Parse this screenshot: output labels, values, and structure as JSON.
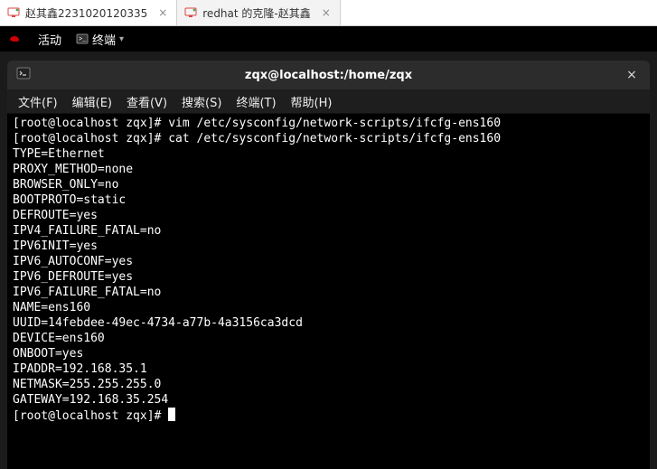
{
  "vm_tabs": [
    {
      "label": "赵其鑫2231020120335",
      "active": true
    },
    {
      "label": "redhat 的克隆-赵其鑫",
      "active": false
    }
  ],
  "panel": {
    "activities": "活动",
    "app": "终端"
  },
  "window": {
    "title": "zqx@localhost:/home/zqx",
    "close": "×"
  },
  "menu": {
    "file": "文件(F)",
    "edit": "编辑(E)",
    "view": "查看(V)",
    "search": "搜索(S)",
    "terminal": "终端(T)",
    "help": "帮助(H)"
  },
  "prompt": {
    "user_host": "[root@localhost zqx]#"
  },
  "terminal_lines": [
    {
      "prompt": true,
      "cmd": "vim /etc/sysconfig/network-scripts/ifcfg-ens160"
    },
    {
      "prompt": true,
      "cmd": "cat /etc/sysconfig/network-scripts/ifcfg-ens160"
    },
    {
      "text": "TYPE=Ethernet"
    },
    {
      "text": "PROXY_METHOD=none"
    },
    {
      "text": "BROWSER_ONLY=no"
    },
    {
      "text": "BOOTPROTO=static"
    },
    {
      "text": "DEFROUTE=yes"
    },
    {
      "text": "IPV4_FAILURE_FATAL=no"
    },
    {
      "text": "IPV6INIT=yes"
    },
    {
      "text": "IPV6_AUTOCONF=yes"
    },
    {
      "text": "IPV6_DEFROUTE=yes"
    },
    {
      "text": "IPV6_FAILURE_FATAL=no"
    },
    {
      "text": "NAME=ens160"
    },
    {
      "text": "UUID=14febdee-49ec-4734-a77b-4a3156ca3dcd"
    },
    {
      "text": "DEVICE=ens160"
    },
    {
      "text": "ONBOOT=yes"
    },
    {
      "text": "IPADDR=192.168.35.1"
    },
    {
      "text": "NETMASK=255.255.255.0"
    },
    {
      "text": "GATEWAY=192.168.35.254"
    },
    {
      "prompt": true,
      "cmd": "",
      "cursor": true
    }
  ]
}
